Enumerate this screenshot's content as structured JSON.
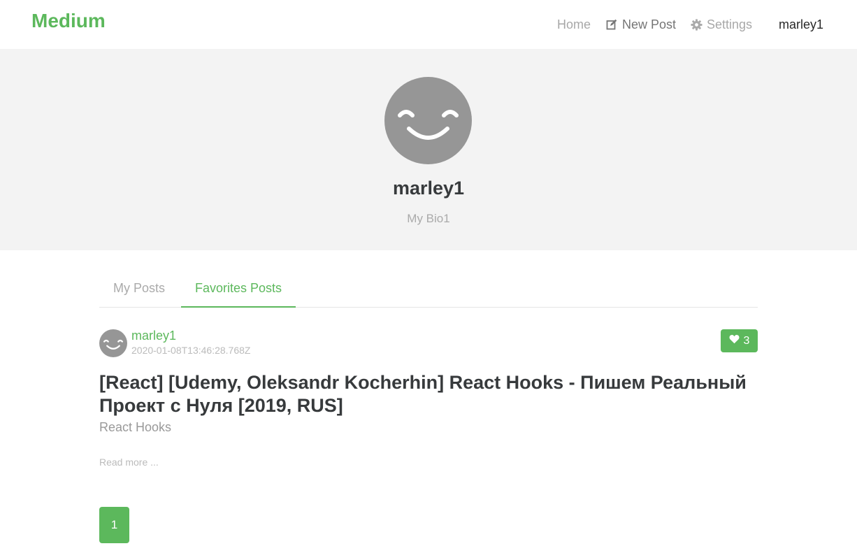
{
  "navbar": {
    "brand": "Medium",
    "home": "Home",
    "new_post": "New Post",
    "settings": "Settings",
    "user": "marley1",
    "icons": {
      "new_post": "edit-icon",
      "settings": "gear-icon"
    }
  },
  "profile": {
    "username": "marley1",
    "bio": "My Bio1",
    "avatar": "smiley-avatar"
  },
  "tabs": [
    {
      "label": "My Posts",
      "active": false
    },
    {
      "label": "Favorites Posts",
      "active": true
    }
  ],
  "articles": [
    {
      "author": "marley1",
      "date": "2020-01-08T13:46:28.768Z",
      "favorites_count": "3",
      "title": "[React] [Udemy, Oleksandr Kocherhin] React Hooks - Пишем Реальный Проект с Нуля [2019, RUS]",
      "description": "React Hooks",
      "read_more": "Read more ..."
    }
  ],
  "pagination": {
    "pages": [
      "1"
    ],
    "current": "1"
  },
  "colors": {
    "accent": "#5cb85c",
    "banner_bg": "#f3f3f3",
    "avatar_bg": "#969696"
  }
}
